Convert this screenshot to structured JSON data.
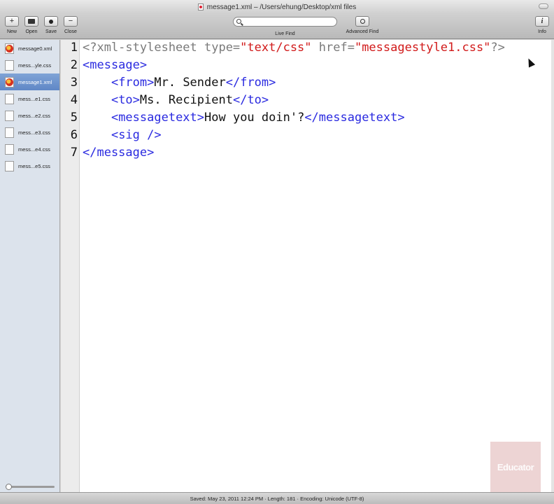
{
  "window": {
    "title": "message1.xml – /Users/ehung/Desktop/xml files"
  },
  "toolbar": {
    "new_label": "New",
    "open_label": "Open",
    "save_label": "Save",
    "close_label": "Close",
    "new_glyph": "+",
    "close_glyph": "−",
    "live_find_label": "Live Find",
    "advanced_find_label": "Advanced Find",
    "info_label": "Info",
    "info_glyph": "i",
    "search_value": ""
  },
  "sidebar": {
    "items": [
      {
        "label": "message0.xml",
        "type": "xml",
        "selected": false
      },
      {
        "label": "mess...yle.css",
        "type": "css",
        "selected": false
      },
      {
        "label": "message1.xml",
        "type": "xml",
        "selected": true
      },
      {
        "label": "mess...e1.css",
        "type": "css",
        "selected": false
      },
      {
        "label": "mess...e2.css",
        "type": "css",
        "selected": false
      },
      {
        "label": "mess...e3.css",
        "type": "css",
        "selected": false
      },
      {
        "label": "mess...e4.css",
        "type": "css",
        "selected": false
      },
      {
        "label": "mess...e5.css",
        "type": "css",
        "selected": false
      }
    ]
  },
  "editor": {
    "line_numbers": [
      "1",
      "2",
      "3",
      "4",
      "5",
      "6",
      "7"
    ],
    "lines": [
      [
        {
          "t": "<?xml-stylesheet type=",
          "c": "pi"
        },
        {
          "t": "\"text/css\"",
          "c": "str"
        },
        {
          "t": " href=",
          "c": "pi"
        },
        {
          "t": "\"messagestyle1.css\"",
          "c": "str"
        },
        {
          "t": "?>",
          "c": "pi"
        }
      ],
      [
        {
          "t": "<message>",
          "c": "tag"
        }
      ],
      [
        {
          "t": "    ",
          "c": "txt"
        },
        {
          "t": "<from>",
          "c": "tag"
        },
        {
          "t": "Mr. Sender",
          "c": "txt"
        },
        {
          "t": "</from>",
          "c": "tag"
        }
      ],
      [
        {
          "t": "    ",
          "c": "txt"
        },
        {
          "t": "<to>",
          "c": "tag"
        },
        {
          "t": "Ms. Recipient",
          "c": "txt"
        },
        {
          "t": "</to>",
          "c": "tag"
        }
      ],
      [
        {
          "t": "    ",
          "c": "txt"
        },
        {
          "t": "<messagetext>",
          "c": "tag"
        },
        {
          "t": "How you doin'?",
          "c": "txt"
        },
        {
          "t": "</messagetext>",
          "c": "tag"
        }
      ],
      [
        {
          "t": "    ",
          "c": "txt"
        },
        {
          "t": "<sig />",
          "c": "tag"
        }
      ],
      [
        {
          "t": "</message>",
          "c": "tag"
        }
      ]
    ]
  },
  "statusbar": {
    "text": "Saved: May 23, 2011 12:24 PM  ·  Length: 181  ·  Encoding: Unicode (UTF-8)"
  },
  "watermark": {
    "text": "Educator"
  },
  "colors": {
    "tag": "#2a2ae0",
    "string": "#d11a1a",
    "processing_instruction": "#7a7a7a",
    "selection": "#6a90cc"
  }
}
